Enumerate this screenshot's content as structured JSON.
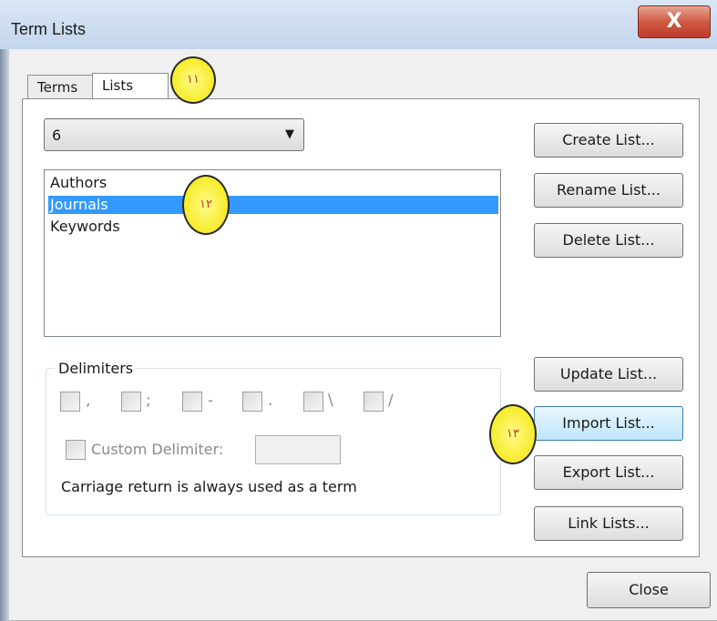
{
  "window": {
    "title": "Term Lists",
    "close_glyph": "X"
  },
  "tabs": [
    {
      "label": "Terms",
      "active": false
    },
    {
      "label": "Lists",
      "active": true
    }
  ],
  "list_selector": {
    "value": "6",
    "arrow": "▼"
  },
  "lists": {
    "items": [
      {
        "label": "Authors",
        "selected": false
      },
      {
        "label": "Journals",
        "selected": true
      },
      {
        "label": "Keywords",
        "selected": false
      }
    ]
  },
  "buttons": {
    "create": "Create List...",
    "rename": "Rename List...",
    "delete": "Delete List...",
    "update": "Update List...",
    "import": "Import List...",
    "export": "Export List...",
    "link": "Link Lists...",
    "close": "Close"
  },
  "delimiters": {
    "legend": "Delimiters",
    "options": [
      {
        "symbol": ",",
        "checked": false
      },
      {
        "symbol": ";",
        "checked": false
      },
      {
        "symbol": "-",
        "checked": false
      },
      {
        "symbol": ".",
        "checked": false
      },
      {
        "symbol": "\\",
        "checked": false
      },
      {
        "symbol": "/",
        "checked": false
      }
    ],
    "custom_label": "Custom Delimiter:",
    "custom_value": "",
    "note": "Carriage return is always used as a term"
  },
  "annotations": [
    {
      "label": "۱۱"
    },
    {
      "label": "۱۲"
    },
    {
      "label": "۱۳"
    }
  ],
  "colors": {
    "selection": "#3399ff",
    "badge": "#f3e500",
    "close_button": "#c0392b"
  }
}
